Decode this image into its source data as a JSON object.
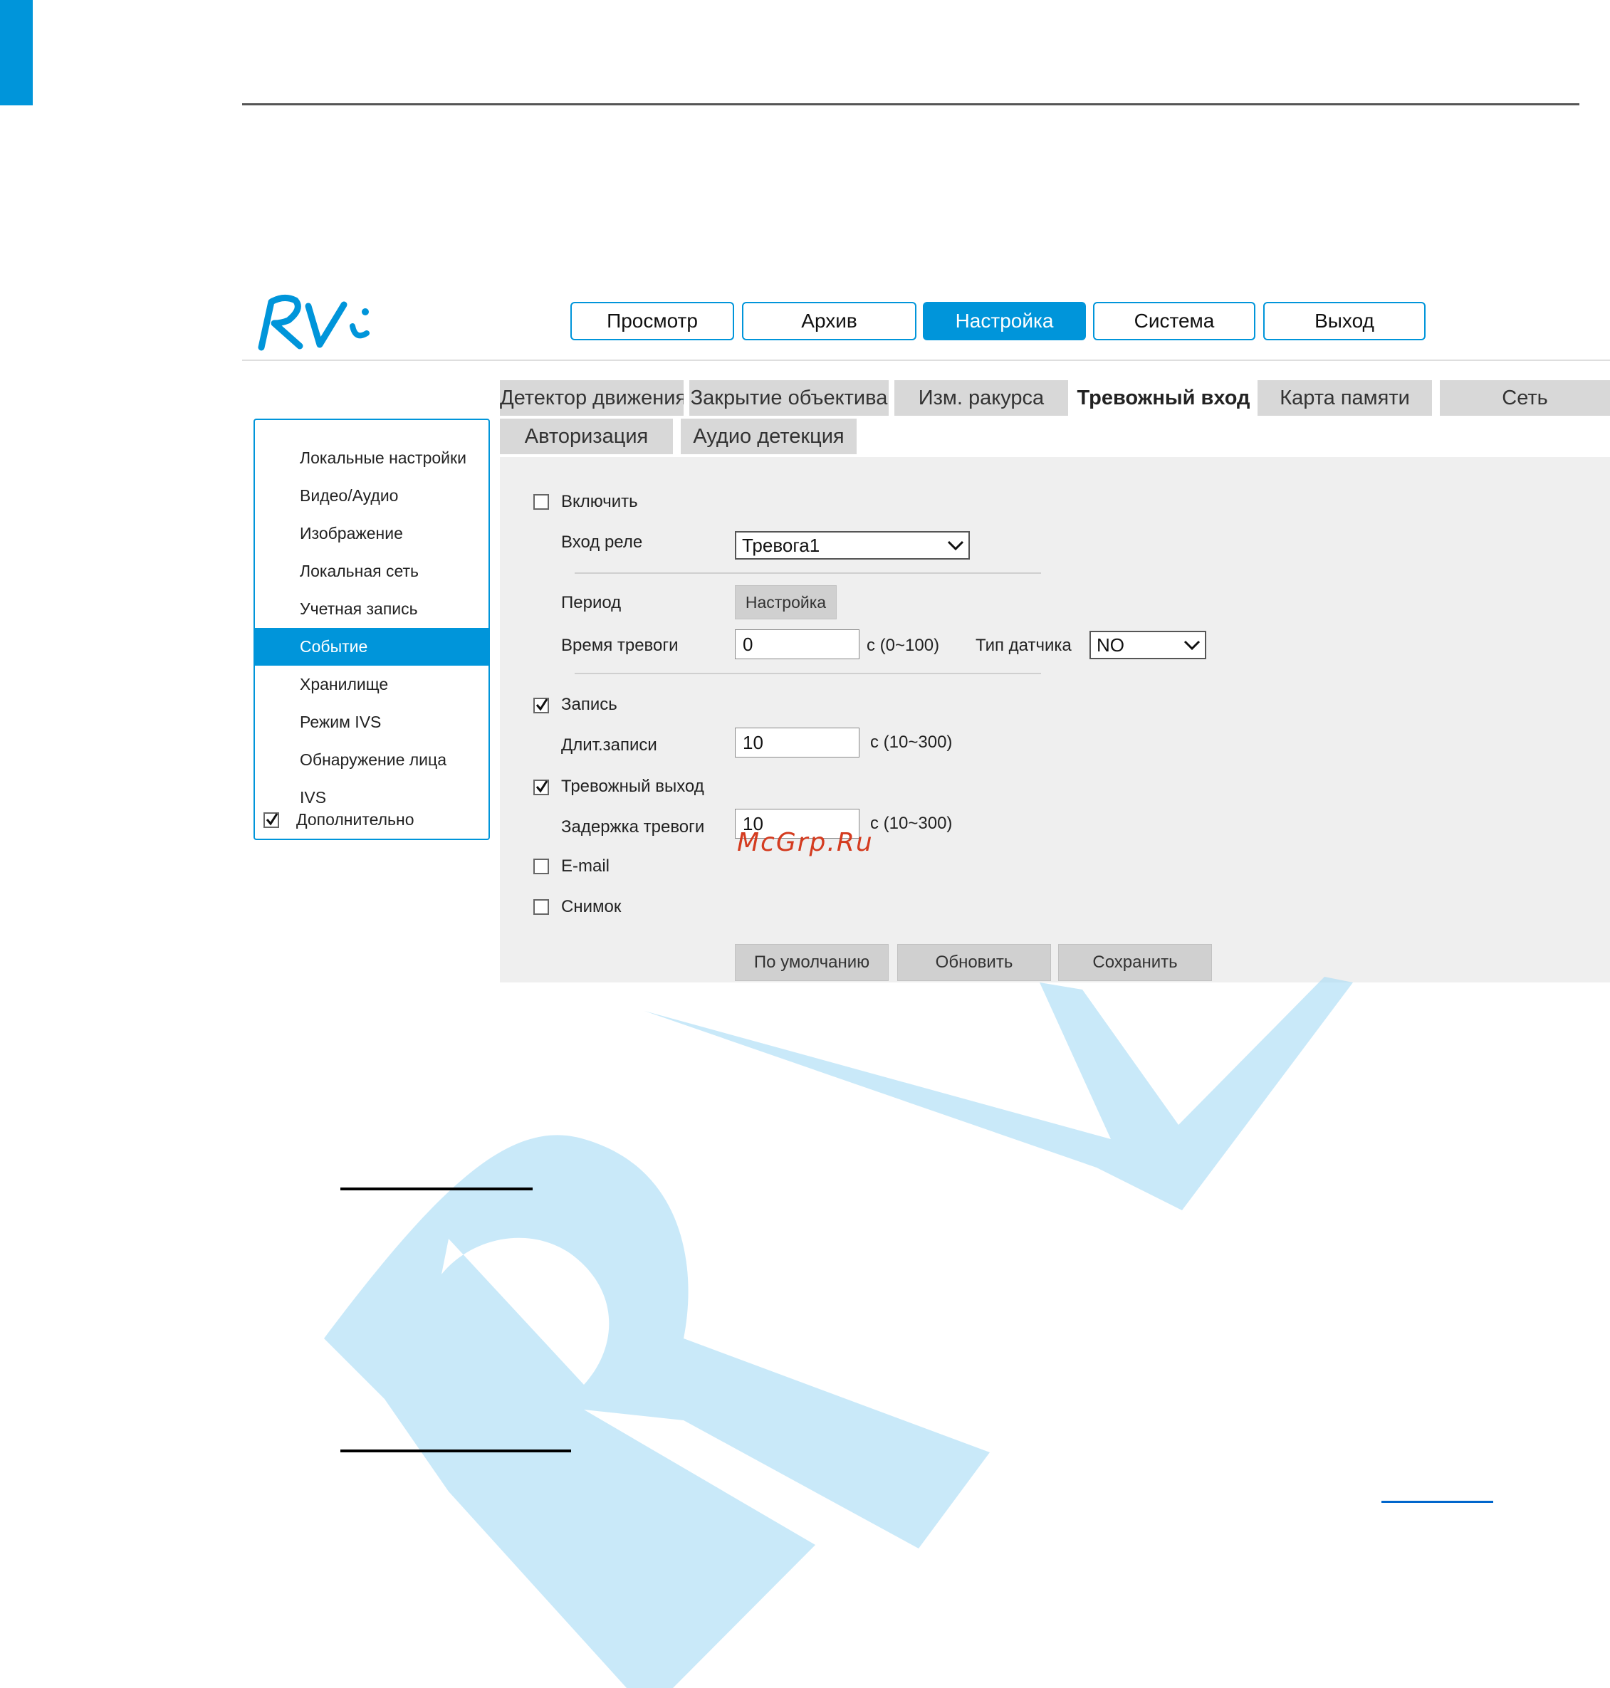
{
  "brand": {
    "logo_text": "RVi",
    "accent_color": "#0095da"
  },
  "nav": [
    "Просмотр",
    "Архив",
    "Настройка",
    "Система",
    "Выход"
  ],
  "nav_active": "Настройка",
  "sidebar": {
    "items": [
      "Локальные настройки",
      "Видео/Аудио",
      "Изображение",
      "Локальная сеть",
      "Учетная запись",
      "Событие",
      "Хранилище",
      "Режим IVS",
      "Обнаружение лица",
      "IVS"
    ],
    "active": "Событие",
    "extra": {
      "label": "Дополнительно",
      "checked": true
    }
  },
  "tabs": {
    "row1": [
      "Детектор движения",
      "Закрытие объектива",
      "Изм. ракурса",
      "Тревожный вход",
      "Карта памяти",
      "Сеть"
    ],
    "row2": [
      "Авторизация",
      "Аудио детекция"
    ],
    "active": "Тревожный вход"
  },
  "form": {
    "enable": {
      "label": "Включить",
      "checked": false
    },
    "relay_input": {
      "label": "Вход реле",
      "value": "Тревога1"
    },
    "period": {
      "label": "Период",
      "button": "Настройка"
    },
    "alarm_time": {
      "label": "Время тревоги",
      "value": "0",
      "range": "с (0~100)"
    },
    "sensor_type": {
      "label": "Тип датчика",
      "value": "NO"
    },
    "record": {
      "label": "Запись",
      "checked": true
    },
    "record_length": {
      "label": "Длит.записи",
      "value": "10",
      "range": "с (10~300)"
    },
    "alarm_out": {
      "label": "Тревожный выход",
      "checked": true
    },
    "alarm_delay": {
      "label": "Задержка тревоги",
      "value": "10",
      "range": "с (10~300)"
    },
    "email": {
      "label": "E-mail",
      "checked": false
    },
    "snapshot": {
      "label": "Снимок",
      "checked": false
    }
  },
  "buttons": {
    "default": "По умолчанию",
    "refresh": "Обновить",
    "save": "Сохранить"
  },
  "watermark_site": "McGrp.Ru"
}
